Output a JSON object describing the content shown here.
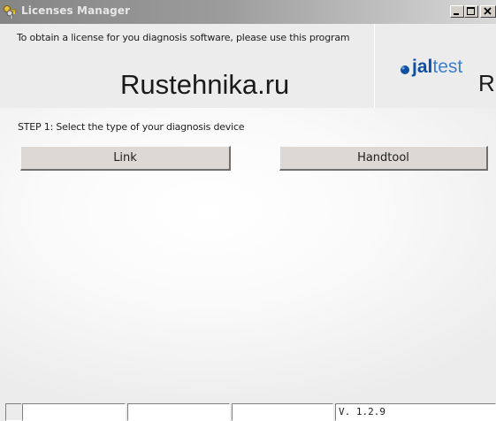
{
  "window": {
    "title": "Licenses Manager",
    "icon": "keys-icon",
    "controls": [
      "minimize-icon",
      "maximize-icon",
      "close-icon"
    ]
  },
  "header": {
    "intro_text": "To obtain a license for you diagnosis software, please use this program",
    "watermark": "Rustehnika.ru",
    "logo_bold": "jal",
    "logo_thin": "test",
    "logo_extra": "R"
  },
  "step": {
    "label": "STEP 1: Select the type of your diagnosis device",
    "buttons": [
      {
        "label": "Link"
      },
      {
        "label": "Handtool"
      }
    ]
  },
  "statusbar": {
    "cells": [
      "",
      "",
      "",
      "V. 1.2.9"
    ]
  },
  "colors": {
    "logo_blue": "#0d4fa0",
    "logo_light_blue": "#3f7fc6",
    "titlebar_inactive": "#9c9c9c"
  }
}
